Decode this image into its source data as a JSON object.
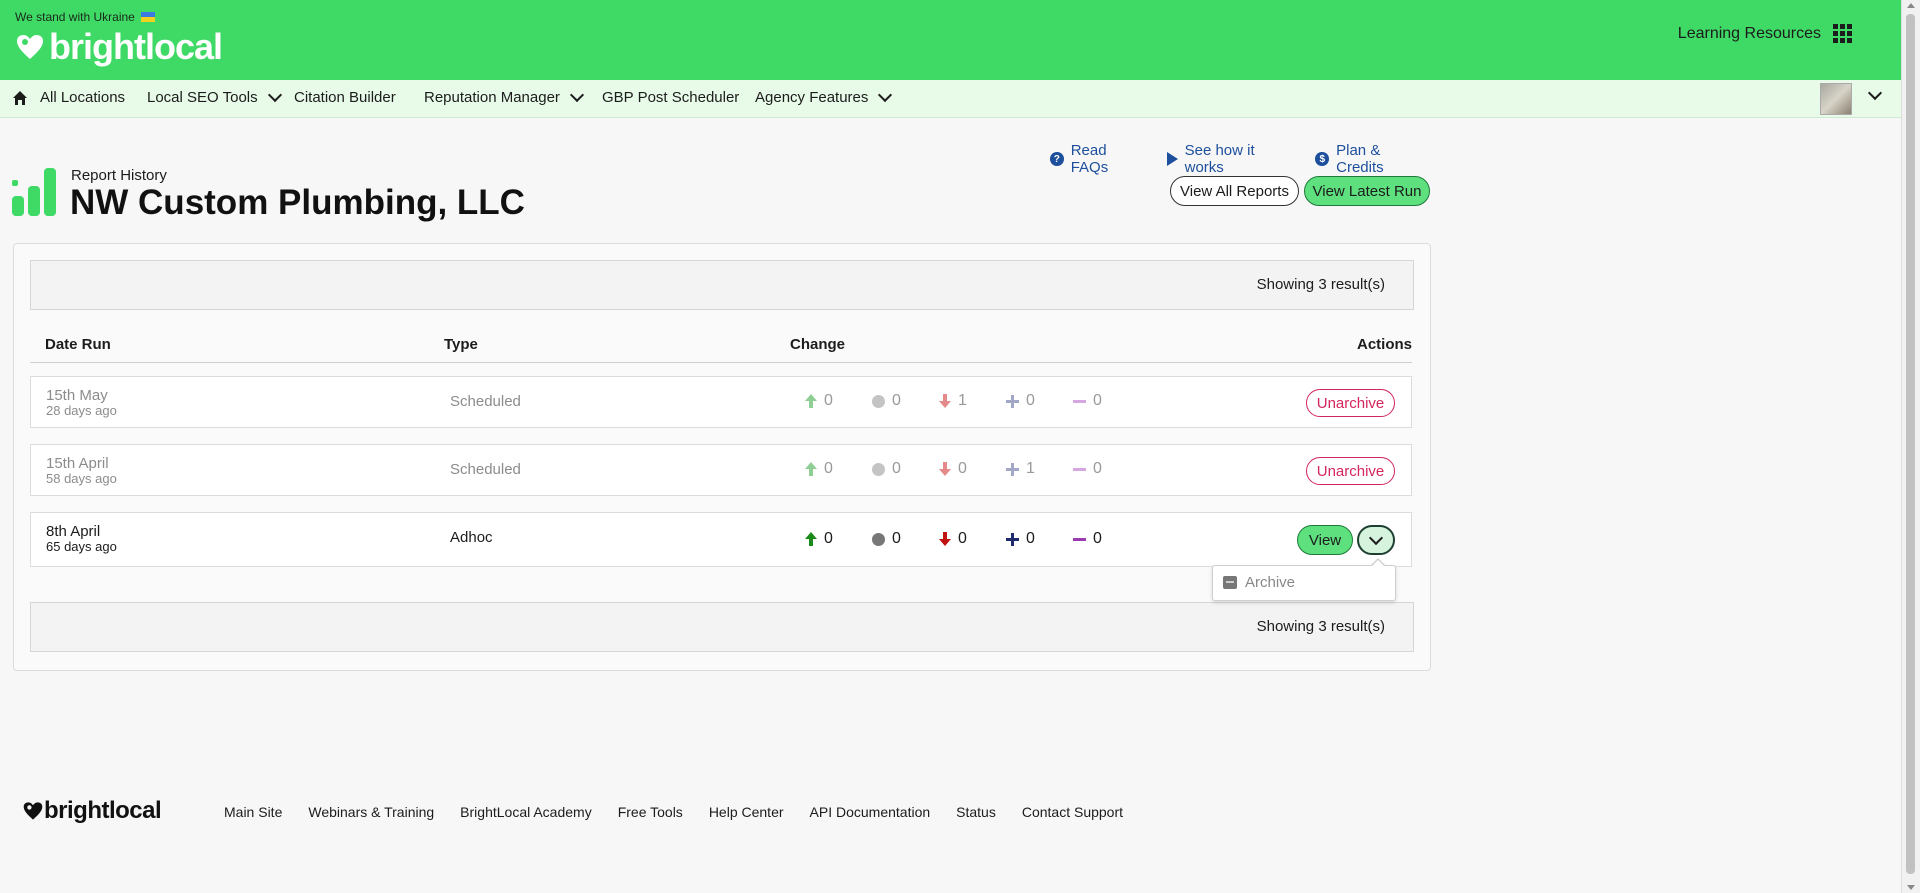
{
  "banner": {
    "ukraine_text": "We stand with Ukraine",
    "logo_text": "brightlocal",
    "learning_resources": "Learning Resources",
    "brand_green": "#3fd966"
  },
  "nav": {
    "items": [
      {
        "label": "All Locations",
        "icon": "home-icon"
      },
      {
        "label": "Local SEO Tools",
        "dropdown": true
      },
      {
        "label": "Citation Builder"
      },
      {
        "label": "Reputation Manager",
        "dropdown": true
      },
      {
        "label": "GBP Post Scheduler"
      },
      {
        "label": "Agency Features",
        "dropdown": true
      }
    ]
  },
  "header": {
    "eyebrow": "Report History",
    "title": "NW Custom Plumbing, LLC",
    "links": {
      "faqs": "Read FAQs",
      "how": "See how it works",
      "plan": "Plan & Credits"
    },
    "buttons": {
      "view_all": "View All Reports",
      "view_latest": "View Latest Run"
    }
  },
  "table": {
    "results_text": "Showing 3 result(s)",
    "columns": {
      "date": "Date Run",
      "type": "Type",
      "change": "Change",
      "actions": "Actions"
    },
    "rows": [
      {
        "date": "15th May",
        "ago": "28 days ago",
        "type": "Scheduled",
        "up": "0",
        "same": "0",
        "down": "1",
        "new": "0",
        "lost": "0",
        "action": "Unarchive",
        "archived": true
      },
      {
        "date": "15th April",
        "ago": "58 days ago",
        "type": "Scheduled",
        "up": "0",
        "same": "0",
        "down": "0",
        "new": "1",
        "lost": "0",
        "action": "Unarchive",
        "archived": true
      },
      {
        "date": "8th April",
        "ago": "65 days ago",
        "type": "Adhoc",
        "up": "0",
        "same": "0",
        "down": "0",
        "new": "0",
        "lost": "0",
        "action": "View",
        "archived": false
      }
    ],
    "dropdown": {
      "archive": "Archive"
    }
  },
  "footer": {
    "logo_text": "brightlocal",
    "links": [
      "Main Site",
      "Webinars & Training",
      "BrightLocal Academy",
      "Free Tools",
      "Help Center",
      "API Documentation",
      "Status",
      "Contact Support"
    ]
  }
}
